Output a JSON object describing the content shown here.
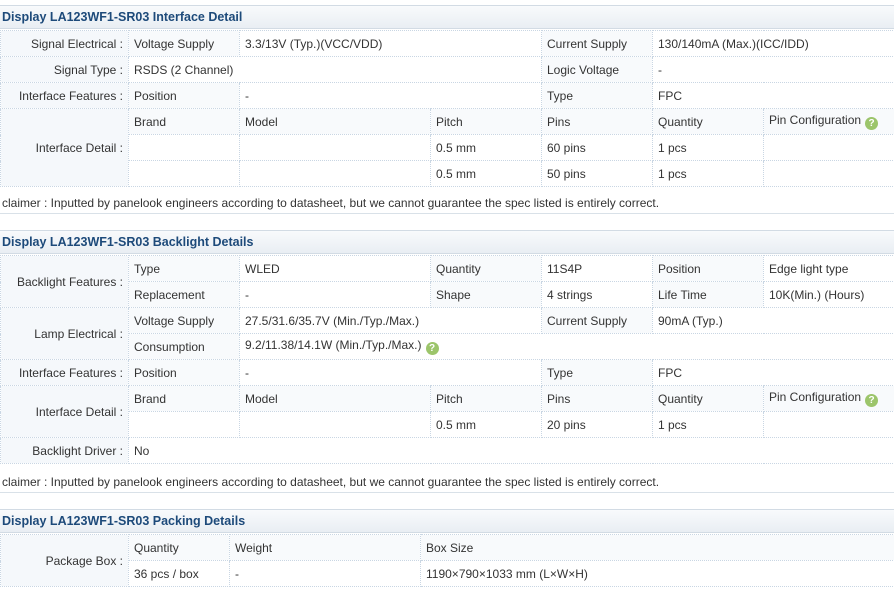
{
  "interface": {
    "title": "Display LA123WF1-SR03 Interface Detail",
    "signal_electrical_label": "Signal Electrical :",
    "voltage_supply_label": "Voltage Supply",
    "voltage_supply_value": "3.3/13V (Typ.)(VCC/VDD)",
    "current_supply_label": "Current Supply",
    "current_supply_value": "130/140mA (Max.)(ICC/IDD)",
    "signal_type_label": "Signal Type :",
    "signal_type_value": "RSDS (2 Channel)",
    "logic_voltage_label": "Logic Voltage",
    "logic_voltage_value": "-",
    "features_label": "Interface Features :",
    "position_label": "Position",
    "position_value": "-",
    "type_label": "Type",
    "type_value": "FPC",
    "detail_label": "Interface Detail :",
    "columns": [
      "Brand",
      "Model",
      "Pitch",
      "Pins",
      "Quantity",
      "Pin Configuration"
    ],
    "rows": [
      {
        "brand": "",
        "model": "",
        "pitch": "0.5 mm",
        "pins": "60 pins",
        "quantity": "1 pcs",
        "pin_config": ""
      },
      {
        "brand": "",
        "model": "",
        "pitch": "0.5 mm",
        "pins": "50 pins",
        "quantity": "1 pcs",
        "pin_config": ""
      }
    ],
    "disclaimer": "claimer : Inputted by panelook engineers according to datasheet, but we cannot guarantee the spec listed is entirely correct."
  },
  "backlight": {
    "title": "Display LA123WF1-SR03 Backlight Details",
    "features_label": "Backlight Features :",
    "type_label": "Type",
    "type_value": "WLED",
    "quantity_label": "Quantity",
    "quantity_value": "11S4P",
    "position_label": "Position",
    "position_value": "Edge light type",
    "replacement_label": "Replacement",
    "replacement_value": "-",
    "shape_label": "Shape",
    "shape_value": "4 strings",
    "life_time_label": "Life Time",
    "life_time_value": "10K(Min.) (Hours)",
    "lamp_electrical_label": "Lamp Electrical :",
    "voltage_supply_label": "Voltage Supply",
    "voltage_supply_value": "27.5/31.6/35.7V (Min./Typ./Max.)",
    "current_supply_label": "Current Supply",
    "current_supply_value": "90mA (Typ.)",
    "consumption_label": "Consumption",
    "consumption_value": "9.2/11.38/14.1W (Min./Typ./Max.)",
    "iface_features_label": "Interface Features :",
    "iface_position_label": "Position",
    "iface_position_value": "-",
    "iface_type_label": "Type",
    "iface_type_value": "FPC",
    "detail_label": "Interface Detail :",
    "columns": [
      "Brand",
      "Model",
      "Pitch",
      "Pins",
      "Quantity",
      "Pin Configuration"
    ],
    "rows": [
      {
        "brand": "",
        "model": "",
        "pitch": "0.5 mm",
        "pins": "20 pins",
        "quantity": "1 pcs",
        "pin_config": ""
      }
    ],
    "driver_label": "Backlight Driver :",
    "driver_value": "No",
    "disclaimer": "claimer : Inputted by panelook engineers according to datasheet, but we cannot guarantee the spec listed is entirely correct."
  },
  "packing": {
    "title": "Display LA123WF1-SR03 Packing Details",
    "box_label": "Package Box :",
    "columns": [
      "Quantity",
      "Weight",
      "Box Size"
    ],
    "row": {
      "quantity": "36 pcs / box",
      "weight": "-",
      "box_size": "1190×790×1033 mm (L×W×H)"
    }
  },
  "icons": {
    "help_glyph": "?",
    "help_icon": "help-icon",
    "help_color": "#9cc56b"
  }
}
